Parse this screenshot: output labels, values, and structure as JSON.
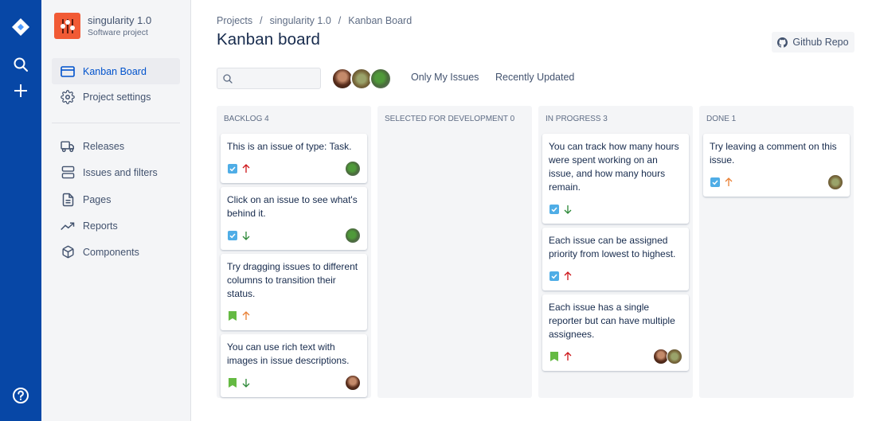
{
  "colors": {
    "navbar": "#0747a6",
    "project_icon": "#f15a35",
    "task_icon": "#4fade6",
    "story_icon": "#65ba43",
    "priority_high": "#cd1317",
    "priority_medium": "#e97f33",
    "priority_low": "#2a8735",
    "accent": "#0052cc"
  },
  "navbar": {
    "icons": [
      "jira-logo-icon",
      "search-icon",
      "plus-icon",
      "help-icon"
    ]
  },
  "sidebar": {
    "project_name": "singularity 1.0",
    "project_type": "Software project",
    "items": [
      {
        "label": "Kanban Board",
        "icon": "board-icon",
        "active": true
      },
      {
        "label": "Project settings",
        "icon": "gear-icon",
        "active": false
      },
      {
        "label": "Releases",
        "icon": "truck-icon",
        "active": false
      },
      {
        "label": "Issues and filters",
        "icon": "server-icon",
        "active": false
      },
      {
        "label": "Pages",
        "icon": "file-text-icon",
        "active": false
      },
      {
        "label": "Reports",
        "icon": "trending-up-icon",
        "active": false
      },
      {
        "label": "Components",
        "icon": "box-icon",
        "active": false
      }
    ]
  },
  "header": {
    "breadcrumb": [
      "Projects",
      "singularity 1.0",
      "Kanban Board"
    ],
    "breadcrumb_sep": "/",
    "title": "Kanban board",
    "github_label": "Github Repo"
  },
  "filters": {
    "search_placeholder": "",
    "search_value": "",
    "users": [
      "user-1",
      "user-2",
      "user-3"
    ],
    "only_my_issues": "Only My Issues",
    "recently_updated": "Recently Updated"
  },
  "board": {
    "columns": [
      {
        "title": "Backlog 4",
        "issues": [
          {
            "title": "This is an issue of type: Task.",
            "type": "task",
            "priority": "high",
            "assignees": [
              "user-3"
            ]
          },
          {
            "title": "Click on an issue to see what's behind it.",
            "type": "task",
            "priority": "low",
            "assignees": [
              "user-3"
            ]
          },
          {
            "title": "Try dragging issues to different columns to transition their status.",
            "type": "story",
            "priority": "medium",
            "assignees": []
          },
          {
            "title": "You can use rich text with images in issue descriptions.",
            "type": "story",
            "priority": "low",
            "assignees": [
              "user-1"
            ]
          }
        ]
      },
      {
        "title": "Selected for development 0",
        "issues": []
      },
      {
        "title": "In progress 3",
        "issues": [
          {
            "title": "You can track how many hours were spent working on an issue, and how many hours remain.",
            "type": "task",
            "priority": "low",
            "assignees": []
          },
          {
            "title": "Each issue can be assigned priority from lowest to highest.",
            "type": "task",
            "priority": "high",
            "assignees": []
          },
          {
            "title": "Each issue has a single reporter but can have multiple assignees.",
            "type": "story",
            "priority": "high",
            "assignees": [
              "user-1",
              "user-2"
            ]
          }
        ]
      },
      {
        "title": "Done 1",
        "issues": [
          {
            "title": "Try leaving a comment on this issue.",
            "type": "task",
            "priority": "medium",
            "assignees": [
              "user-2"
            ]
          }
        ]
      }
    ]
  }
}
